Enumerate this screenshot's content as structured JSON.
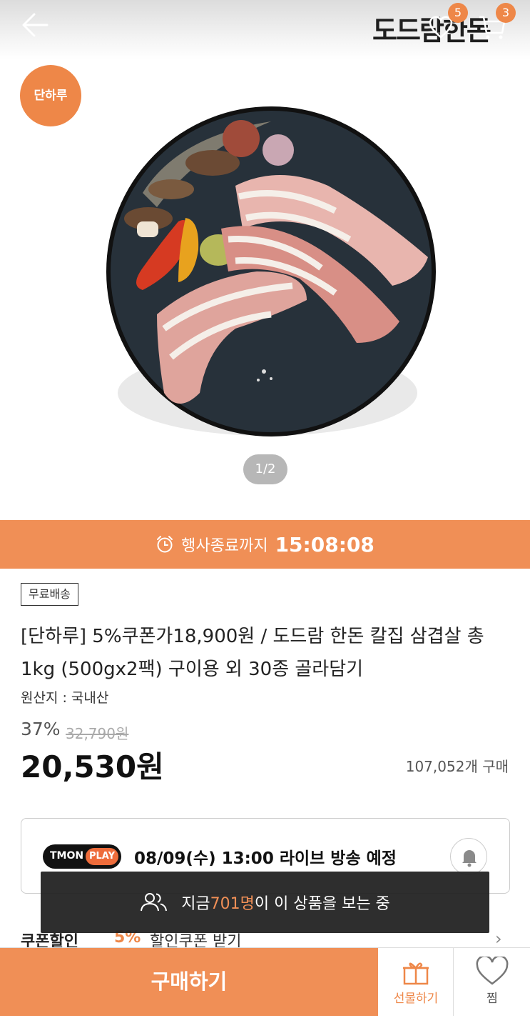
{
  "header": {
    "brand": "도드람한돈",
    "wishlist_count": "5",
    "cart_count": "3",
    "icons": [
      "back-arrow-icon",
      "heart-icon",
      "cart-icon"
    ]
  },
  "hero": {
    "badge": "단하루",
    "pager": "1/2"
  },
  "timer": {
    "label": "행사종료까지",
    "time": "15:08:08"
  },
  "product": {
    "tag": "무료배송",
    "title": "[단하루] 5%쿠폰가18,900원 / 도드람 한돈 칼집 삼겹살 총1kg (500gx2팩) 구이용 외 30종 골라담기",
    "origin": "원산지 : 국내산",
    "discount": "37%",
    "original_price": "32,790원",
    "price": "20,530원",
    "sold": "107,052개 구매"
  },
  "live": {
    "logo_text": "TMON",
    "logo_play": "PLAY",
    "text": "08/09(수) 13:00 라이브 방송 예정"
  },
  "coupon": {
    "label": "쿠폰할인",
    "percent": "5%",
    "text": "할인쿠폰 받기",
    "arrow": "›"
  },
  "toast": {
    "prefix": "지금 ",
    "count": "701명",
    "suffix": "이 이 상품을 보는 중"
  },
  "bottom": {
    "buy": "구매하기",
    "gift": "선물하기",
    "like": "찜"
  },
  "colors": {
    "accent": "#ee8748",
    "timer_bg": "#f08f56",
    "toast_bg": "#1e1e1e"
  }
}
